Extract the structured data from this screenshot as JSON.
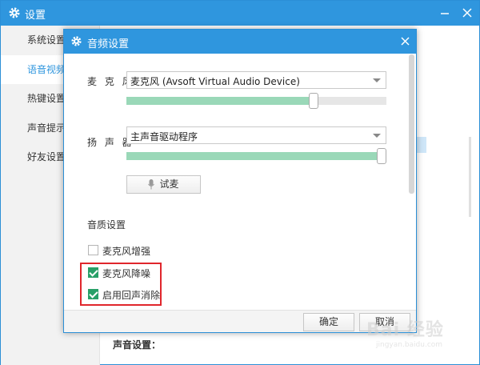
{
  "background_window": {
    "title": "设置",
    "sidebar": [
      {
        "label": "系统设置",
        "active": false
      },
      {
        "label": "语音视频",
        "active": true
      },
      {
        "label": "热键设置",
        "active": false
      },
      {
        "label": "声音提示",
        "active": false
      },
      {
        "label": "好友设置",
        "active": false
      }
    ],
    "sound_settings_label": "声音设置："
  },
  "dialog": {
    "title": "音频设置",
    "microphone": {
      "label": "麦 克 风",
      "device": "麦克风 (Avsoft Virtual Audio Device)",
      "volume_fraction": 0.73
    },
    "speaker": {
      "label": "扬 声 器",
      "device": "主声音驱动程序",
      "volume_fraction": 1.0
    },
    "test_button": "试麦",
    "quality_section_title": "音质设置",
    "options": [
      {
        "label": "麦克风增强",
        "checked": false
      },
      {
        "label": "麦克风降噪",
        "checked": true
      },
      {
        "label": "启用回声消除",
        "checked": true
      }
    ],
    "ok_button": "确定",
    "cancel_button": "取消"
  },
  "watermark": {
    "logo": "Bai 经验",
    "site": "jingyan.baidu.com"
  },
  "colors": {
    "titlebar": "#2f96de",
    "checkbox_checked": "#28a068",
    "slider_fill": "#9ad8b8",
    "highlight_box": "#e0262c"
  }
}
